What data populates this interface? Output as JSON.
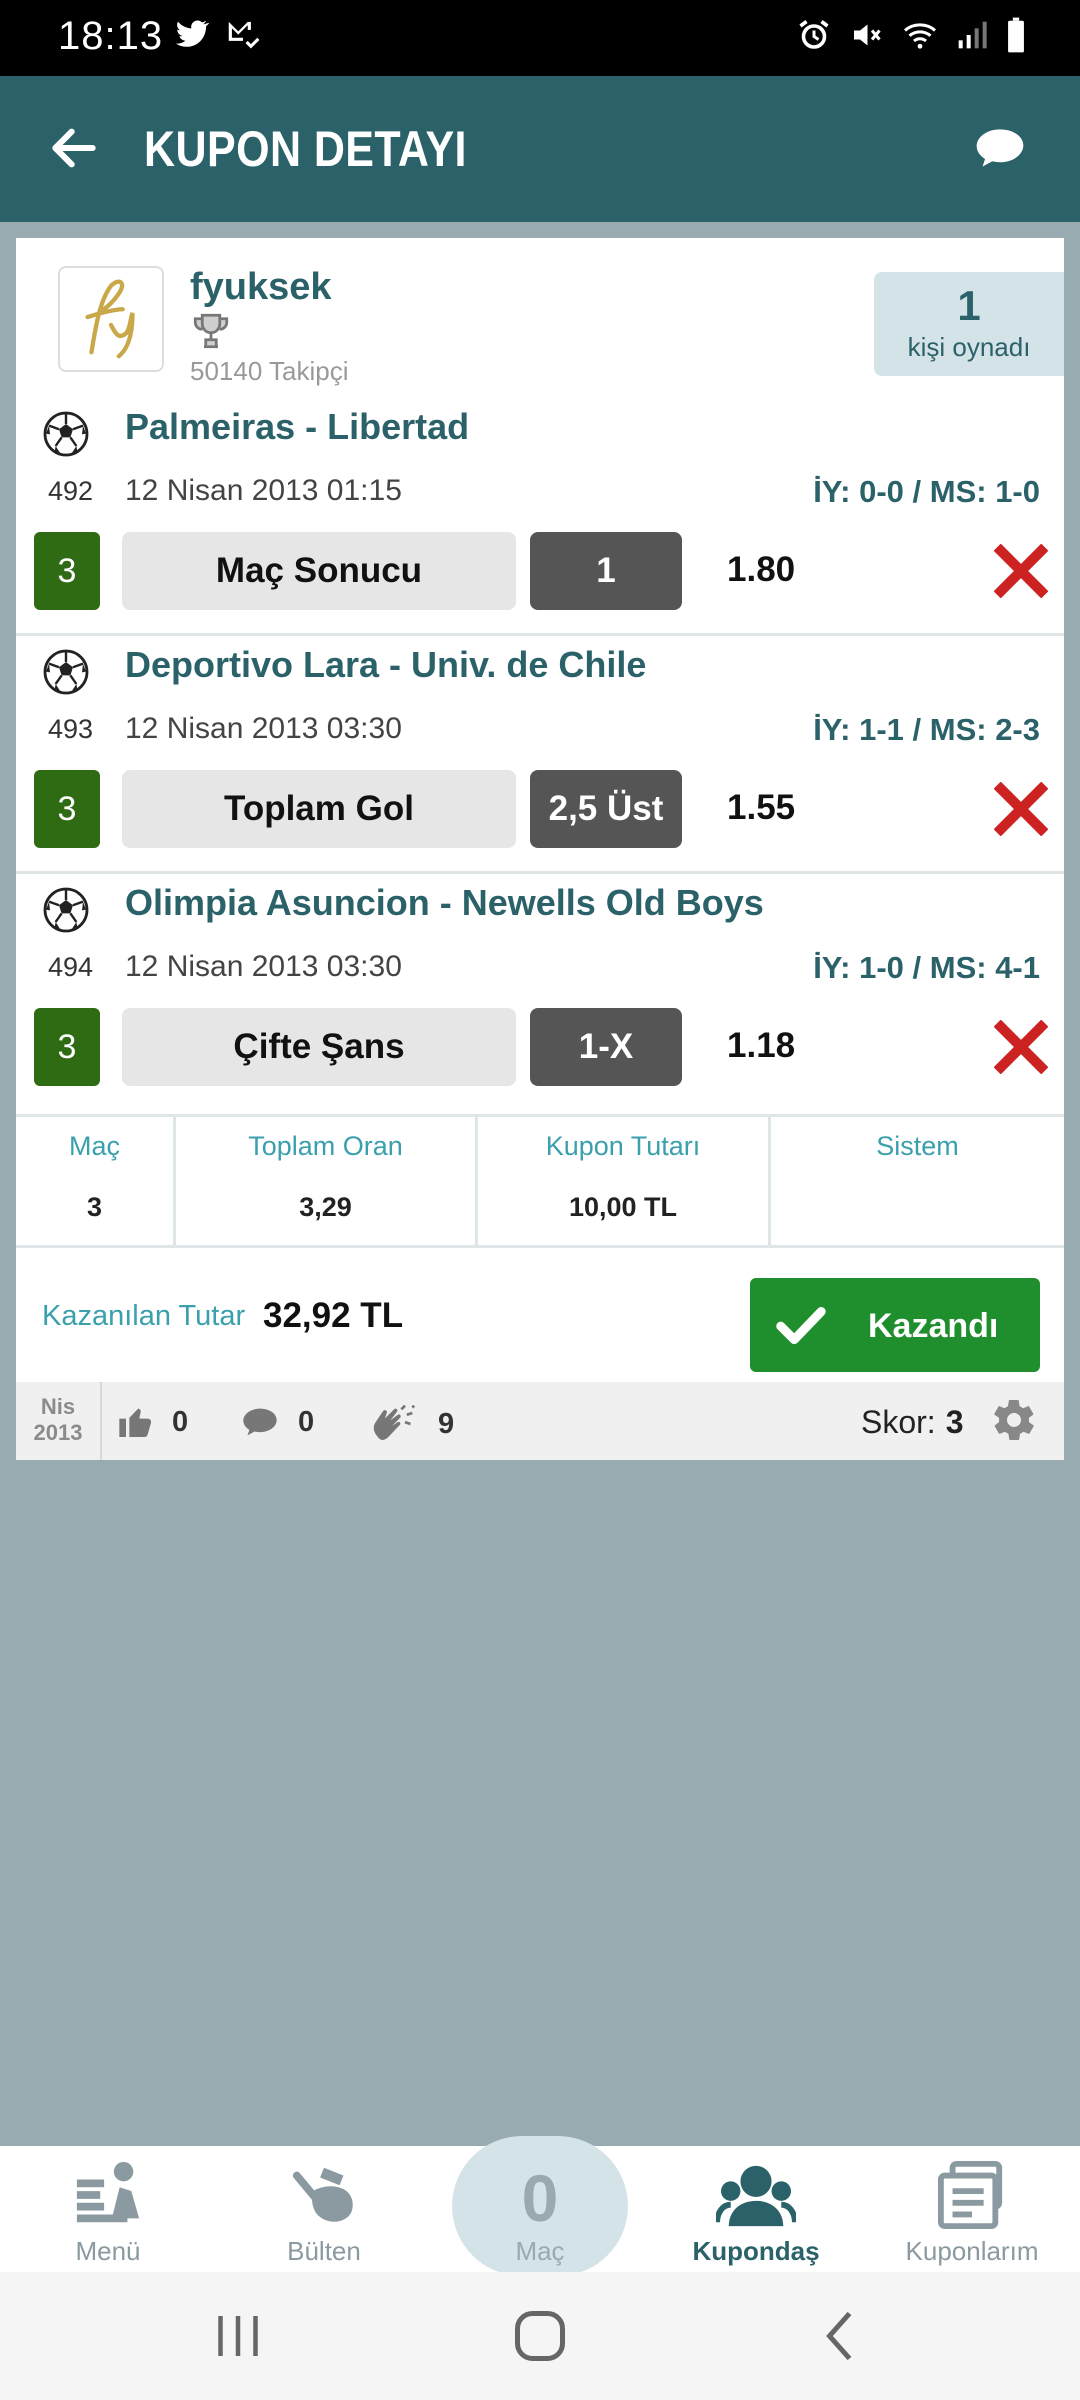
{
  "status_bar": {
    "time": "18:13",
    "left_icons": [
      "twitter-icon",
      "email-check-icon"
    ],
    "right_icons": [
      "alarm-icon",
      "mute-icon",
      "wifi-icon",
      "signal-icon",
      "battery-icon"
    ]
  },
  "app_bar": {
    "title": "KUPON DETAYI",
    "back_icon": "arrow-left-icon",
    "chat_icon": "chat-bubble-icon"
  },
  "user": {
    "name": "fyuksek",
    "followers": "50140 Takipçi",
    "played_count": "1",
    "played_label": "kişi oynadı"
  },
  "matches": [
    {
      "teams": "Palmeiras - Libertad",
      "code": "492",
      "date": "12 Nisan 2013 01:15",
      "score": "İY: 0-0 / MS: 1-0",
      "badge": "3",
      "market": "Maç Sonucu",
      "pick": "1",
      "odds": "1.80",
      "result": "lost"
    },
    {
      "teams": "Deportivo Lara - Univ. de Chile",
      "code": "493",
      "date": "12 Nisan 2013 03:30",
      "score": "İY: 1-1 / MS: 2-3",
      "badge": "3",
      "market": "Toplam Gol",
      "pick": "2,5 Üst",
      "odds": "1.55",
      "result": "lost"
    },
    {
      "teams": "Olimpia Asuncion - Newells Old Boys",
      "code": "494",
      "date": "12 Nisan 2013 03:30",
      "score": "İY: 1-0 / MS: 4-1",
      "badge": "3",
      "market": "Çifte Şans",
      "pick": "1-X",
      "odds": "1.18",
      "result": "lost"
    }
  ],
  "summary": {
    "mac_label": "Maç",
    "mac_value": "3",
    "oran_label": "Toplam Oran",
    "oran_value": "3,29",
    "tutar_label": "Kupon Tutarı",
    "tutar_value": "10,00 TL",
    "sistem_label": "Sistem",
    "sistem_value": ""
  },
  "winnings": {
    "label": "Kazanılan Tutar",
    "value": "32,92 TL",
    "status_label": "Kazandı"
  },
  "social": {
    "month": "Nis",
    "year": "2013",
    "likes": "0",
    "comments": "0",
    "claps": "9",
    "score_label": "Skor:",
    "score_value": "3"
  },
  "bottom_nav": {
    "menu": "Menü",
    "bulten": "Bülten",
    "center_count": "0",
    "center_label": "Maç",
    "kupondas": "Kupondaş",
    "kuponlarim": "Kuponlarım",
    "active": "Kupondaş"
  },
  "colors": {
    "primary": "#2b6168",
    "accent": "#3aa0ad",
    "won": "#1f8f2e",
    "lost": "#cc2222",
    "badge": "#2f6b12"
  }
}
